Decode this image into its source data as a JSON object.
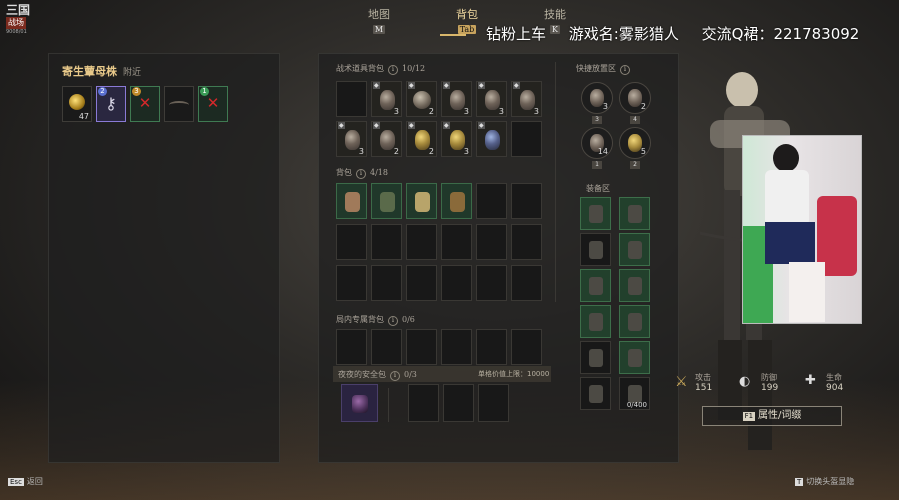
{
  "logo": {
    "line1": "三国",
    "line2": "战场",
    "line3": "9008/01"
  },
  "tabs": [
    {
      "label": "地图",
      "key": "M"
    },
    {
      "label": "背包",
      "key": "Tab"
    },
    {
      "label": "技能",
      "key": "K"
    }
  ],
  "stream_overlay": {
    "a": "钻粉上车",
    "b": "游戏名:雾影猎人",
    "c": "交流Q裙：221783092"
  },
  "left_panel": {
    "title": "寄生蕈母株",
    "subtitle": "附近",
    "slots": [
      {
        "count": "47",
        "num": ""
      },
      {
        "num": "2"
      },
      {
        "num": "3"
      },
      {
        "num": ""
      },
      {
        "num": "1"
      }
    ]
  },
  "battle_bag": {
    "title": "战术道具背包",
    "capacity": "10/12",
    "counts": [
      "",
      "3",
      "2",
      "3",
      "3",
      "3",
      "3",
      "2",
      "2",
      "3",
      "",
      ""
    ]
  },
  "quick_slots": {
    "title": "快捷放置区",
    "counts": [
      "3",
      "2",
      "14",
      "5"
    ],
    "keys": [
      "3",
      "4",
      "1",
      "2"
    ]
  },
  "backpack": {
    "title": "背包",
    "capacity": "4/18"
  },
  "equip_area": {
    "title": "装备区",
    "bottom_value": "0/400"
  },
  "mission_bag": {
    "title": "局内专属背包",
    "capacity": "0/6"
  },
  "safe_bag": {
    "title": "夜夜的安全包",
    "capacity": "0/3",
    "money_label": "单格价值上限：10000"
  },
  "stats": {
    "attack_label": "攻击",
    "attack_value": "151",
    "defense_label": "防御",
    "defense_value": "199",
    "hp_label": "生命",
    "hp_value": "904"
  },
  "attr_button": {
    "key": "F1",
    "label": "属性/词缀"
  },
  "bottom": {
    "esc_key": "Esc",
    "esc_label": "返回",
    "toggle_key": "T",
    "toggle_label": "切换头盔显隐"
  },
  "colors": {
    "accent": "#d9b76b",
    "slot_green": "#3b6a48",
    "danger": "#d2282a"
  }
}
